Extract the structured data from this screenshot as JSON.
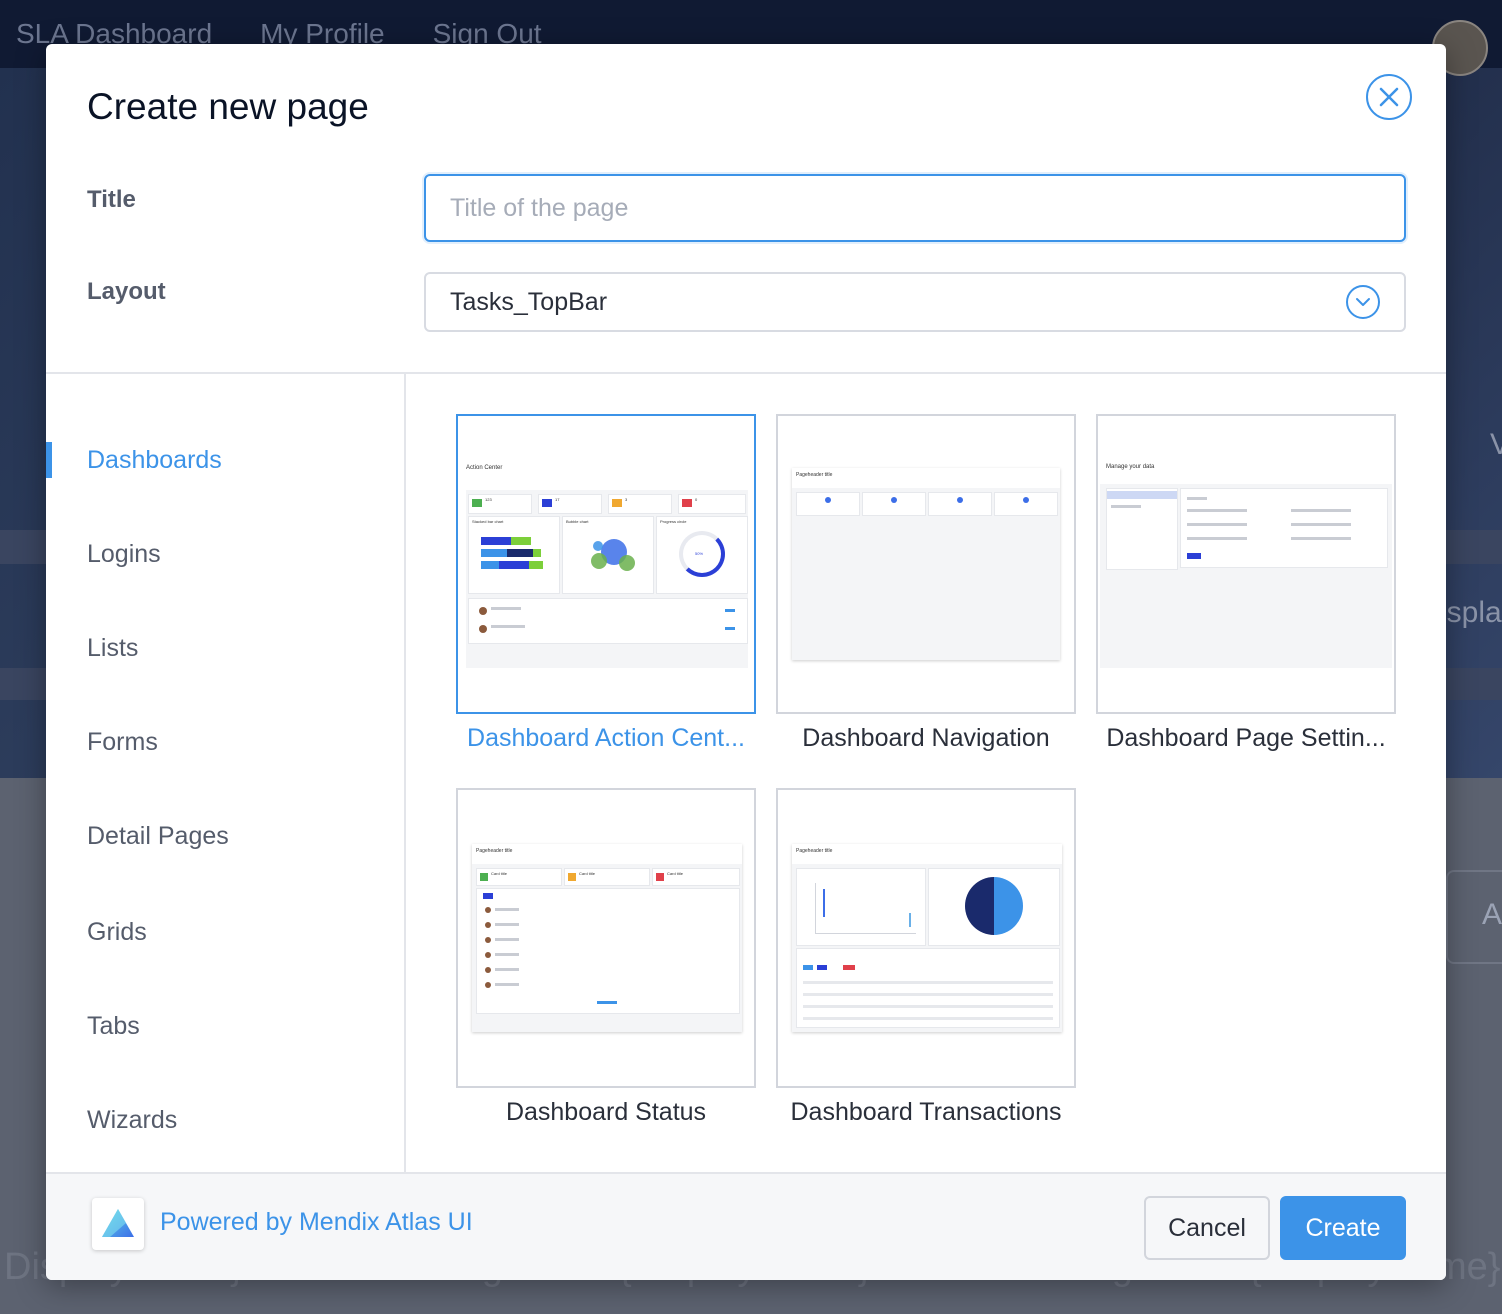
{
  "background": {
    "nav": [
      "SLA Dashboard",
      "My Profile",
      "Sign Out"
    ],
    "footer_texts": [
      "DisplayName}",
      "Assigned to {DisplayName}",
      "Assigned to {DisplayName}"
    ],
    "side_texts": [
      "V",
      "ispla",
      "A"
    ]
  },
  "modal": {
    "title": "Create new page",
    "title_label": "Title",
    "title_value": "",
    "title_placeholder": "Title of the page",
    "layout_label": "Layout",
    "layout_value": "Tasks_TopBar"
  },
  "categories": [
    {
      "label": "Dashboards",
      "active": true
    },
    {
      "label": "Logins",
      "active": false
    },
    {
      "label": "Lists",
      "active": false
    },
    {
      "label": "Forms",
      "active": false
    },
    {
      "label": "Detail Pages",
      "active": false
    },
    {
      "label": "Grids",
      "active": false
    },
    {
      "label": "Tabs",
      "active": false
    },
    {
      "label": "Wizards",
      "active": false
    }
  ],
  "templates": [
    {
      "name": "Dashboard Action Cent...",
      "selected": true,
      "preview": {
        "header": "Action Center",
        "counters": [
          "123",
          "17",
          "3",
          "0"
        ],
        "panels": [
          "Stacked bar chart",
          "Bubble chart",
          "Progress circle"
        ],
        "progress": "50%"
      }
    },
    {
      "name": "Dashboard Navigation",
      "selected": false,
      "preview": {
        "header": "Pageheader title"
      }
    },
    {
      "name": "Dashboard Page Settin...",
      "selected": false,
      "preview": {
        "header": "Manage your data"
      }
    },
    {
      "name": "Dashboard Status",
      "selected": false,
      "preview": {
        "header": "Pageheader title",
        "cards": [
          "Card title",
          "Card title",
          "Card title"
        ]
      }
    },
    {
      "name": "Dashboard Transactions",
      "selected": false,
      "preview": {
        "header": "Pageheader title"
      }
    }
  ],
  "footer": {
    "powered_by": "Powered by Mendix Atlas UI",
    "cancel_label": "Cancel",
    "create_label": "Create"
  },
  "colors": {
    "accent": "#3c93e8",
    "text": "#2a2f3a",
    "label": "#555c6b"
  },
  "icons": {
    "close": "close-icon",
    "layout_dropdown": "chevron-down-icon",
    "logo": "atlas-logo-icon"
  }
}
